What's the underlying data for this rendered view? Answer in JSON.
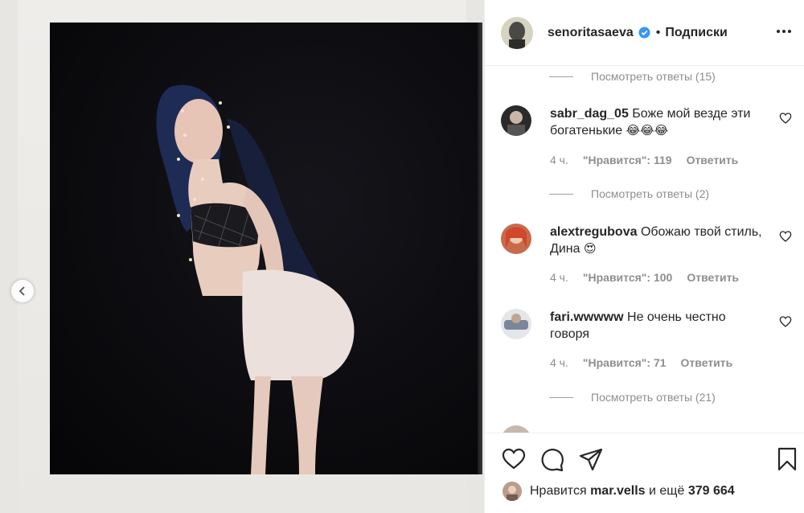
{
  "post": {
    "username": "senoritasaeva",
    "follow_separator": "•",
    "follow_label": "Подписки",
    "more_icon": "more-horizontal-icon"
  },
  "comments": {
    "items": [
      {
        "username": "sabr_dag_05",
        "text": "Боже мой везде эти богатенькие",
        "emoji": "😂😂😂",
        "time": "4 ч.",
        "likes": "\"Нравится\": 119",
        "reply": "Ответить",
        "view_replies": "Посмотреть ответы (2)"
      },
      {
        "username": "alextregubova",
        "text": "Обожаю твой стиль, Дина",
        "emoji": "😍",
        "time": "4 ч.",
        "likes": "\"Нравится\": 100",
        "reply": "Ответить"
      },
      {
        "username": "fari.wwwww",
        "text": "Не очень честно говоря",
        "emoji": "",
        "time": "4 ч.",
        "likes": "\"Нравится\": 71",
        "reply": "Ответить",
        "view_replies": "Посмотреть ответы (21)"
      }
    ],
    "top_view_replies": "Посмотреть ответы (15)"
  },
  "actions": {
    "like_icon": "heart-icon",
    "comment_icon": "comment-icon",
    "share_icon": "send-icon",
    "save_icon": "bookmark-icon",
    "liked_prefix": "Нравится",
    "liked_by": "mar.vells",
    "liked_suffix": "и ещё",
    "liked_count": "379 664"
  },
  "colors": {
    "verified": "#3897f0",
    "muted": "#8e8e8e",
    "text": "#262626"
  }
}
